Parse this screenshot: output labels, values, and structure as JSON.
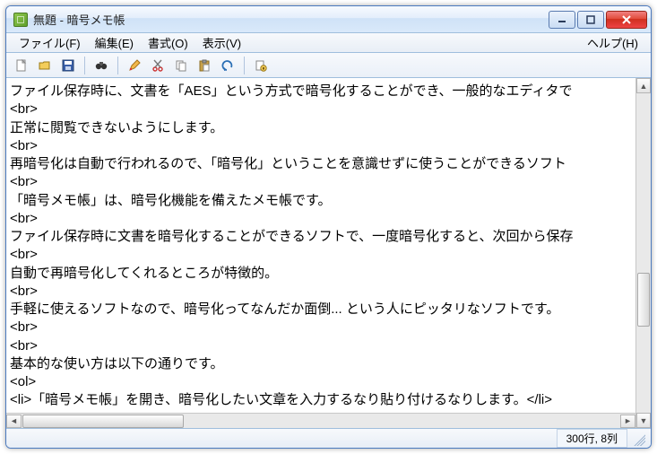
{
  "title": "無題 - 暗号メモ帳",
  "menu": {
    "file": "ファイル(F)",
    "edit": "編集(E)",
    "format": "書式(O)",
    "view": "表示(V)",
    "help": "ヘルプ(H)"
  },
  "toolbar_icons": {
    "new": "new-icon",
    "open": "open-icon",
    "save": "save-icon",
    "find": "find-icon",
    "highlight": "highlight-icon",
    "cut": "cut-icon",
    "copy": "copy-icon",
    "paste": "paste-icon",
    "undo": "undo-icon",
    "encrypt": "encrypt-icon"
  },
  "editor_lines": [
    "ファイル保存時に、文書を「AES」という方式で暗号化することができ、一般的なエディタで",
    "<br>",
    "正常に閲覧できないようにします。",
    "<br>",
    "再暗号化は自動で行われるので、「暗号化」ということを意識せずに使うことができるソフト",
    "<br>",
    "「暗号メモ帳」は、暗号化機能を備えたメモ帳です。",
    "<br>",
    "ファイル保存時に文書を暗号化することができるソフトで、一度暗号化すると、次回から保存",
    "<br>",
    "自動で再暗号化してくれるところが特徴的。",
    "<br>",
    "手軽に使えるソフトなので、暗号化ってなんだか面倒... という人にピッタリなソフトです。",
    "<br>",
    "<br>",
    "基本的な使い方は以下の通りです。",
    "<ol>",
    "<li>「暗号メモ帳」を開き、暗号化したい文章を入力するなり貼り付けるなりします。</li>"
  ],
  "status": {
    "position": "300行, 8列"
  }
}
